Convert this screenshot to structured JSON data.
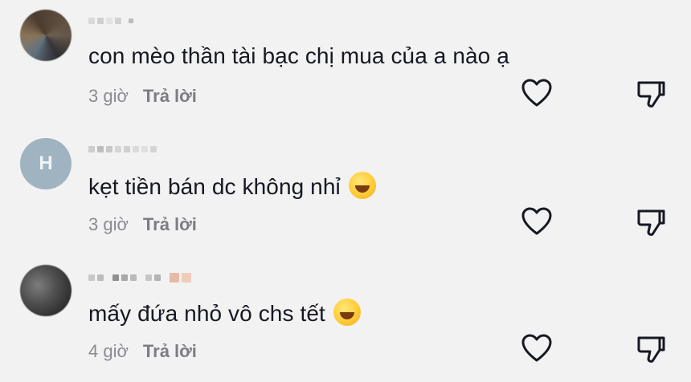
{
  "comments": [
    {
      "username": "",
      "text": "con mèo thần tài bạc chị mua của a nào ạ",
      "time": "3 giờ",
      "reply_label": "Trả lời",
      "emoji": ""
    },
    {
      "username": "",
      "avatar_initial": "H",
      "text": "kẹt tiền bán dc không nhỉ",
      "time": "3 giờ",
      "reply_label": "Trả lời",
      "emoji": "sweat-smile-emoji"
    },
    {
      "username": "",
      "text": "mấy đứa nhỏ vô chs tết",
      "time": "4 giờ",
      "reply_label": "Trả lời",
      "emoji": "laugh-cry-emoji"
    }
  ],
  "icons": {
    "like": "heart-outline-icon",
    "dislike": "thumbs-down-outline-icon"
  },
  "colors": {
    "background": "#f2f2f2",
    "text": "#161823",
    "meta": "#8a8b91",
    "icon": "#161823"
  }
}
